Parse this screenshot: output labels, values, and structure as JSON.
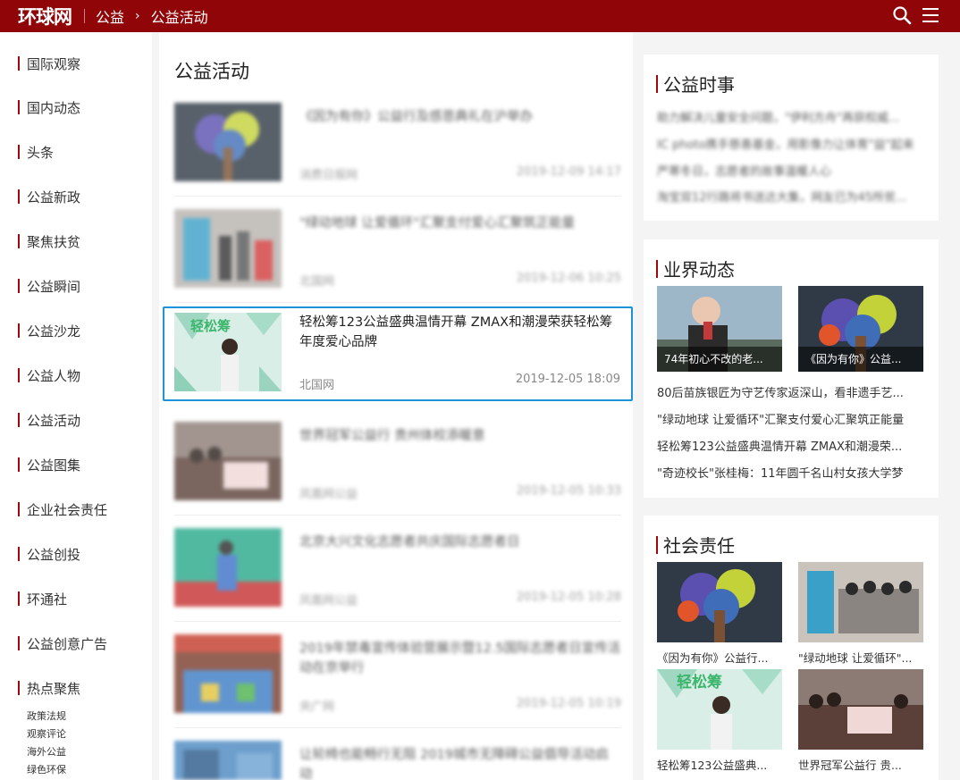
{
  "header": {
    "logo": "环球网",
    "crumb_home": "公益",
    "crumb_arrow": "›",
    "crumb_current": "公益活动"
  },
  "sidebar": {
    "items": [
      "国际观察",
      "国内动态",
      "头条",
      "公益新政",
      "聚焦扶贫",
      "公益瞬间",
      "公益沙龙",
      "公益人物",
      "公益活动",
      "公益图集",
      "企业社会责任",
      "公益创投",
      "环通社",
      "公益创意广告",
      "热点聚焦"
    ],
    "sub_items": [
      "政策法规",
      "观察评论",
      "海外公益",
      "绿色环保"
    ]
  },
  "main": {
    "title": "公益活动",
    "articles": [
      {
        "title": "《因为有你》公益行及感恩典礼在沪举办",
        "source": "消费日报网",
        "time": "2019-12-09 14:17"
      },
      {
        "title": "\"绿动地球 让爱循环\"汇聚支付爱心汇聚筑正能量",
        "source": "北国网",
        "time": "2019-12-06 10:25"
      },
      {
        "title": "轻松筹123公益盛典温情开幕 ZMAX和潮漫荣获轻松筹年度爱心品牌",
        "source": "北国网",
        "time": "2019-12-05 18:09"
      },
      {
        "title": "世界冠军公益行 贵州体校添暖意",
        "source": "凤凰网公益",
        "time": "2019-12-05 10:33"
      },
      {
        "title": "北京大兴文化志愿者共庆国际志愿者日",
        "source": "凤凰网公益",
        "time": "2019-12-05 10:28"
      },
      {
        "title": "2019年禁毒宣传体验营展示暨12.5国际志愿者日宣传活动在京举行",
        "source": "央广网",
        "time": "2019-12-05 10:19"
      },
      {
        "title": "让轮椅也能畅行无阻 2019城市无障碍公益倡导活动启动",
        "source": "",
        "time": ""
      }
    ]
  },
  "panels": {
    "news": {
      "title": "公益时事",
      "lines": [
        "助力解决儿童安全问题，\"伊利方舟\"再获权威...",
        "IC photo携手慈善基金，用影像力让体育\"益\"起来",
        "严寒冬日，志愿者的故事温暖人心",
        "淘宝双12行路将书送达大集，网友已为45所贫..."
      ]
    },
    "industry": {
      "title": "业界动态",
      "pics": [
        "74年初心不改的老...",
        "《因为有你》公益..."
      ],
      "lines": [
        "80后苗族银匠为守艺传家返深山，看非遗手艺...",
        "\"绿动地球 让爱循环\"汇聚支付爱心汇聚筑正能量",
        "轻松筹123公益盛典温情开幕 ZMAX和潮漫荣...",
        "\"奇迹校长\"张桂梅：11年圆千名山村女孩大学梦"
      ]
    },
    "social": {
      "title": "社会责任",
      "pics": [
        "《因为有你》公益行...",
        "\"绿动地球 让爱循环\"...",
        "轻松筹123公益盛典...",
        "世界冠军公益行 贵..."
      ]
    }
  },
  "colors": {
    "brand_red": "#8f0508",
    "accent_red": "#a4060a",
    "highlight_blue": "#1e93dc"
  }
}
